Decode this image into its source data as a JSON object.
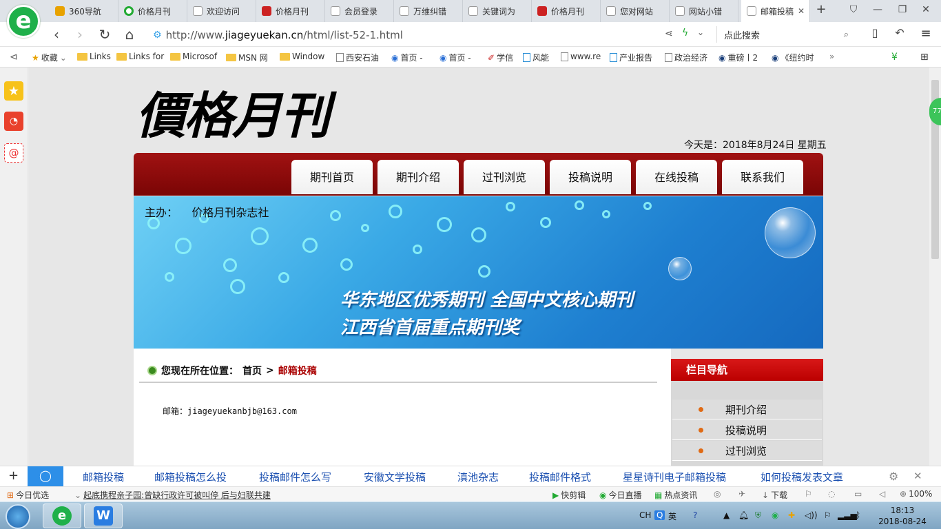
{
  "browser": {
    "tabs": [
      {
        "label": "360导航",
        "color": "#e8a200"
      },
      {
        "label": "价格月刊",
        "color": "#22aa33"
      },
      {
        "label": "欢迎访问",
        "color": "#bbbbbb"
      },
      {
        "label": "价格月刊",
        "color": "#cc2222"
      },
      {
        "label": "会员登录",
        "color": "#bbbbbb"
      },
      {
        "label": "万维纠错",
        "color": "#bbbbbb"
      },
      {
        "label": "关键词为",
        "color": "#bbbbbb"
      },
      {
        "label": "价格月刊",
        "color": "#cc2222"
      },
      {
        "label": "您对网站",
        "color": "#bbbbbb"
      },
      {
        "label": "网站小错",
        "color": "#bbbbbb"
      },
      {
        "label": "邮箱投稿",
        "color": "#bbbbbb"
      }
    ],
    "url_prefix": "http://www.",
    "url_domain": "jiageyuekan.cn",
    "url_path": "/html/list-52-1.html",
    "search_placeholder": "点此搜索",
    "bookmarks": [
      {
        "label": "收藏",
        "icon": "star-icon"
      },
      {
        "label": "Links",
        "icon": "folder-icon"
      },
      {
        "label": "Links for",
        "icon": "folder-icon"
      },
      {
        "label": "Microsof",
        "icon": "folder-icon"
      },
      {
        "label": "MSN 网",
        "icon": "folder-icon"
      },
      {
        "label": "Window",
        "icon": "folder-icon"
      },
      {
        "label": "西安石油",
        "icon": "page-icon"
      },
      {
        "label": "首页 -",
        "icon": "globe-icon"
      },
      {
        "label": "首页 -",
        "icon": "globe-icon"
      },
      {
        "label": "学信",
        "icon": "page-icon"
      },
      {
        "label": "风能",
        "icon": "page-icon"
      },
      {
        "label": "www.re",
        "icon": "page-icon"
      },
      {
        "label": "产业报告",
        "icon": "page-icon"
      },
      {
        "label": "政治经济",
        "icon": "page-icon"
      },
      {
        "label": "重磅丨2",
        "icon": "page-icon"
      },
      {
        "label": "《纽约时",
        "icon": "page-icon"
      }
    ],
    "side_badge": "77"
  },
  "site": {
    "logo_text": "價格月刊",
    "date_text": "今天是：2018年8月24日 星期五",
    "nav": [
      "期刊首页",
      "期刊介绍",
      "过刊浏览",
      "投稿说明",
      "在线投稿",
      "联系我们"
    ],
    "banner": {
      "sponsor_label": "主办：",
      "sponsor_name": "价格月刊杂志社",
      "slogan_line1": "华东地区优秀期刊  全国中文核心期刊",
      "slogan_line2": "江西省首届重点期刊奖"
    },
    "breadcrumb": {
      "label": "您现在所在位置：",
      "home": "首页",
      "sep": ">",
      "current": "邮箱投稿"
    },
    "email_text": "邮箱：jiageyuekanbjb@163.com",
    "sidebar": {
      "title": "栏目导航",
      "items": [
        "期刊介绍",
        "投稿说明",
        "过刊浏览"
      ]
    }
  },
  "related_searches": [
    "邮箱投稿",
    "邮箱投稿怎么投",
    "投稿邮件怎么写",
    "安徽文学投稿",
    "滇池杂志",
    "投稿邮件格式",
    "星星诗刊电子邮箱投稿",
    "如何投稿发表文章"
  ],
  "newsbar": {
    "left_label": "今日优选",
    "headline": "起底携程亲子园:曾缺行政许可被叫停 后与妇联共建",
    "items": [
      "快剪辑",
      "今日直播",
      "热点资讯",
      "下载"
    ],
    "zoom": "100%"
  },
  "taskbar": {
    "lang": "CH",
    "ime": "英",
    "time": "18:13",
    "date": "2018-08-24"
  }
}
